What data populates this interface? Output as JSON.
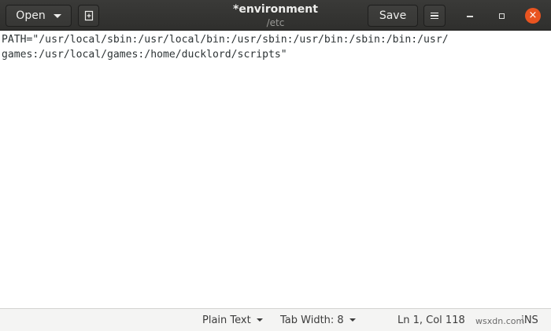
{
  "header": {
    "open_label": "Open",
    "save_label": "Save",
    "title": "*environment",
    "subtitle": "/etc",
    "icons": {
      "open_menu": "chevron-down-icon",
      "new_tab": "new-document-icon",
      "main_menu": "hamburger-menu-icon",
      "minimize": "minimize-icon",
      "maximize": "maximize-icon",
      "close": "close-icon"
    },
    "close_glyph": "×",
    "close_color": "#e95420"
  },
  "editor": {
    "lines": [
      "PATH=\"/usr/local/sbin:/usr/local/bin:/usr/sbin:/usr/bin:/sbin:/bin:/usr/",
      "games:/usr/local/games:/home/ducklord/scripts\""
    ]
  },
  "statusbar": {
    "language": "Plain Text",
    "tab_width": "Tab Width: 8",
    "cursor_position": "Ln 1, Col 118",
    "mode": "INS"
  },
  "watermark": "wsxdn.com"
}
